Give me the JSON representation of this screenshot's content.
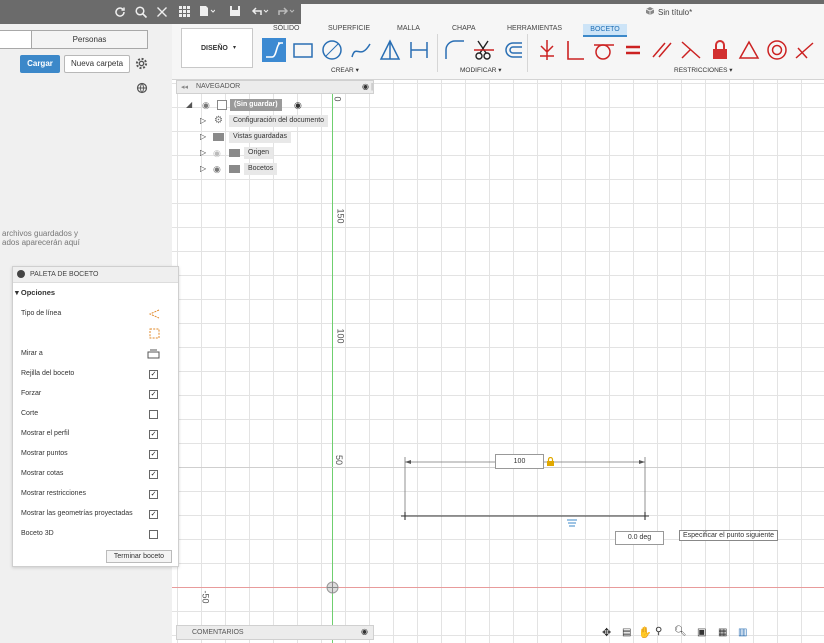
{
  "data_panel": {
    "tabs": [
      "",
      "Personas"
    ],
    "upload_label": "Cargar",
    "new_folder_label": "Nueva carpeta",
    "empty_line1": "archivos guardados y",
    "empty_line2": "ados aparecerán aquí"
  },
  "doc": {
    "title": "Sin título*"
  },
  "toolbar": {
    "workspace": "DISEÑO",
    "tabs": [
      "SÓLIDO",
      "SUPERFICIE",
      "MALLA",
      "CHAPA",
      "HERRAMIENTAS",
      "BOCETO"
    ],
    "active_tab": "BOCETO",
    "groups": [
      "CREAR",
      "MODIFICAR",
      "RESTRICCIONES"
    ]
  },
  "browser": {
    "title": "NAVEGADOR",
    "root": "(Sin guardar)",
    "items": [
      "Configuración del documento",
      "Vistas guardadas",
      "Origen",
      "Bocetos"
    ]
  },
  "palette": {
    "title": "PALETA DE BOCETO",
    "section": "Opciones",
    "line_type_label": "Tipo de línea",
    "look_at_label": "Mirar a",
    "rows": [
      {
        "label": "Rejilla del boceto",
        "checked": true
      },
      {
        "label": "Forzar",
        "checked": true
      },
      {
        "label": "Corte",
        "checked": false
      },
      {
        "label": "Mostrar el perfil",
        "checked": true
      },
      {
        "label": "Mostrar puntos",
        "checked": true
      },
      {
        "label": "Mostrar cotas",
        "checked": true
      },
      {
        "label": "Mostrar restricciones",
        "checked": true
      },
      {
        "label": "Mostrar las geometrías proyectadas",
        "checked": true
      },
      {
        "label": "Boceto 3D",
        "checked": false
      }
    ],
    "finish_label": "Terminar boceto"
  },
  "canvas": {
    "ruler_labels": [
      "150",
      "100",
      "50",
      "-50"
    ],
    "ruler_top_label": "0",
    "dim_value": "100",
    "angle_value": "0.0 deg",
    "tooltip": "Especificar el punto siguiente",
    "axis_colors": {
      "vertical": "#6fcf6f",
      "horizontal": "#e89b9b"
    }
  },
  "comments": {
    "title": "COMENTARIOS"
  },
  "icons": [
    "refresh-icon",
    "search-icon",
    "close-icon",
    "grid-menu-icon",
    "file-icon",
    "save-icon",
    "undo-icon",
    "redo-icon",
    "cube-icon",
    "gear-icon",
    "globe-icon",
    "eye-icon",
    "folder-icon",
    "lock-icon",
    "orbit-icon",
    "pan-icon",
    "zoom-icon",
    "display-icon"
  ]
}
